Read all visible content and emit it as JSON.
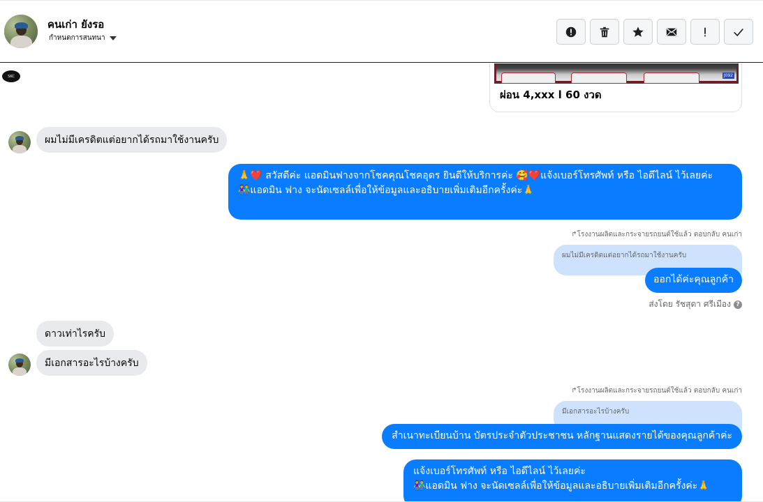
{
  "header": {
    "contact_name": "คนเก่า ยังรอ",
    "assign_label": "กำหนดการสนทนา"
  },
  "actions": [
    {
      "icon": "alert-circle-icon"
    },
    {
      "icon": "trash-icon"
    },
    {
      "icon": "star-icon"
    },
    {
      "icon": "mail-icon"
    },
    {
      "icon": "exclamation-icon"
    },
    {
      "icon": "checkmark-icon"
    }
  ],
  "messages": {
    "card_caption": "ผ่อน 4,xxx l 60 งวด",
    "card_tag": "J092",
    "logo_text": "SKC",
    "in_1": "ผมไม่มีเครดิตแต่อยากได้รถมาใช้งานครับ",
    "out_1_line1": "🙏❤️ สวัสดีค่ะ แอดมินฟางจากโชคคุณโชคอุดร ยินดีให้บริการค่ะ 🥰❤️แจ้งเบอร์โทรศัพท์ หรือ ไอดีไลน์  ไว้เลยค่ะ",
    "out_1_line2": "👫แอดมิน ฟาง จะนัดเซลล์เพื่อให้ข้อมูลและอธิบายเพิ่มเติมอีกครั้งค่ะ🙏",
    "reply_meta_1": "↱โรงงานผลิตและกระจายรถยนต์ใช้แล้ว ตอบกลับ คนเก่า",
    "quote_1": "ผมไม่มีเครดิตแต่อยากได้รถมาใช้งานครับ",
    "out_2": "ออกได้ค่ะคุณลูกค้า",
    "sent_by": "ส่งโดย รัชสุดา ศรีเมือง",
    "in_2": "ดาวเท่าไรครับ",
    "in_3": "มีเอกสารอะไรบ้างครับ",
    "reply_meta_2": "↱โรงงานผลิตและกระจายรถยนต์ใช้แล้ว ตอบกลับ คนเก่า",
    "quote_2": "มีเอกสารอะไรบ้างครับ",
    "out_3": "สำเนาทะเบียนบ้าน บัตรประจำตัวประชาชน หลักฐานแสดงรายได้ของคุณลูกค้าค่ะ",
    "out_4_line1": "แจ้งเบอร์โทรศัพท์ หรือ ไอดีไลน์  ไว้เลยค่ะ",
    "out_4_line2": "👫แอดมิน ฟาง จะนัดเซลล์เพื่อให้ข้อมูลและอธิบายเพิ่มเติมอีกครั้งค่ะ🙏"
  },
  "colors": {
    "outgoing_bubble": "#0a7cff",
    "incoming_bubble": "#e9eaed",
    "quote_bubble": "#cfe2fd"
  }
}
